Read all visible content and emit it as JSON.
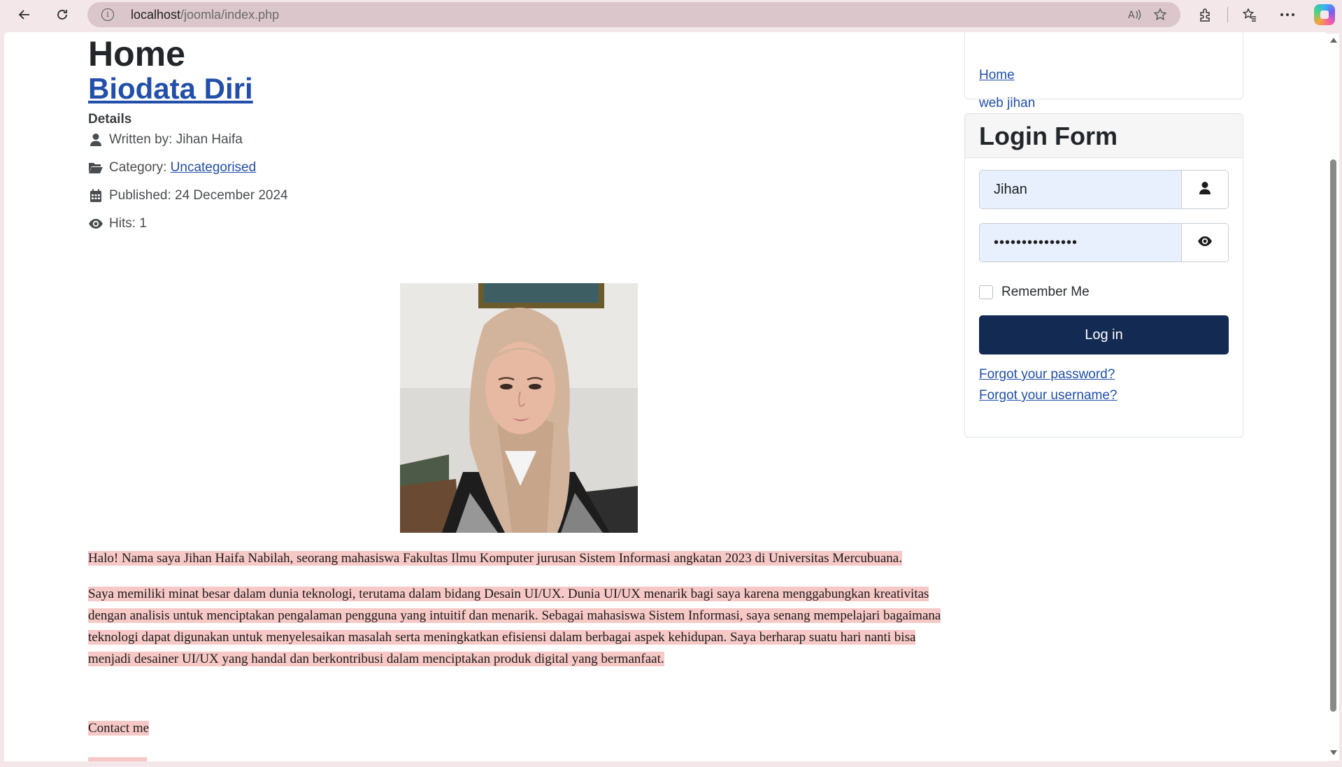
{
  "browser": {
    "url_host": "localhost",
    "url_path": "/joomla/index.php"
  },
  "article": {
    "page_heading": "Home",
    "title": "Biodata Diri",
    "details_label": "Details",
    "meta": {
      "author": "Written by: Jihan Haifa",
      "category_prefix": "Category: ",
      "category_link": "Uncategorised",
      "published": "Published: 24 December 2024",
      "hits": "Hits: 1"
    },
    "paragraphs": [
      "Halo! Nama saya Jihan Haifa Nabilah, seorang mahasiswa Fakultas Ilmu Komputer jurusan Sistem Informasi angkatan 2023 di Universitas Mercubuana.",
      "Saya memiliki minat besar dalam dunia teknologi, terutama dalam bidang Desain UI/UX. Dunia UI/UX menarik bagi saya karena menggabungkan kreativitas dengan analisis untuk menciptakan pengalaman pengguna yang intuitif dan menarik. Sebagai mahasiswa Sistem Informasi, saya senang mempelajari bagaimana teknologi dapat digunakan untuk menyelesaikan masalah serta meningkatkan efisiensi dalam berbagai aspek kehidupan. Saya berharap suatu hari nanti bisa menjadi desainer UI/UX yang handal dan berkontribusi dalam menciptakan produk digital yang bermanfaat."
    ],
    "contact": "Contact me"
  },
  "sidebar": {
    "menu_items": [
      "Home",
      "web jihan"
    ],
    "login": {
      "title": "Login Form",
      "username_value": "Jihan",
      "password_value": "•••••••••••••••",
      "remember_label": "Remember Me",
      "button_label": "Log in",
      "forgot_password": "Forgot your password?",
      "forgot_username": "Forgot your username?"
    }
  },
  "colors": {
    "link": "#224faa",
    "login_button": "#132a52",
    "highlight": "#f6c8c6",
    "autofill_bg": "#e8f0fe"
  }
}
